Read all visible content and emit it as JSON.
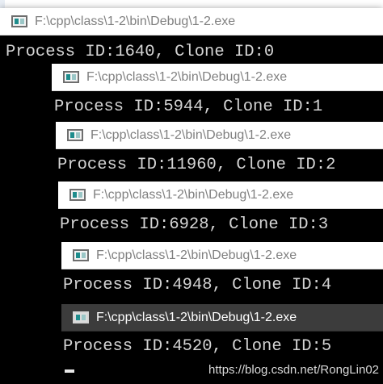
{
  "windows": [
    {
      "title": "F:\\cpp\\class\\1-2\\bin\\Debug\\1-2.exe",
      "output": "Process ID:1640, Clone ID:0",
      "active": false
    },
    {
      "title": "F:\\cpp\\class\\1-2\\bin\\Debug\\1-2.exe",
      "output": "Process ID:5944, Clone ID:1",
      "active": false
    },
    {
      "title": "F:\\cpp\\class\\1-2\\bin\\Debug\\1-2.exe",
      "output": "Process ID:11960, Clone ID:2",
      "active": false
    },
    {
      "title": "F:\\cpp\\class\\1-2\\bin\\Debug\\1-2.exe",
      "output": "Process ID:6928, Clone ID:3",
      "active": false
    },
    {
      "title": "F:\\cpp\\class\\1-2\\bin\\Debug\\1-2.exe",
      "output": "Process ID:4948, Clone ID:4",
      "active": false
    },
    {
      "title": "F:\\cpp\\class\\1-2\\bin\\Debug\\1-2.exe",
      "output": "Process ID:4520, Clone ID:5",
      "active": true
    }
  ],
  "watermark": "https://blog.csdn.net/RongLin02",
  "colors": {
    "console_bg": "#000000",
    "console_text": "#d4d4d4",
    "active_titlebar": "#3c3c3c",
    "inactive_titlebar": "#ffffff"
  }
}
